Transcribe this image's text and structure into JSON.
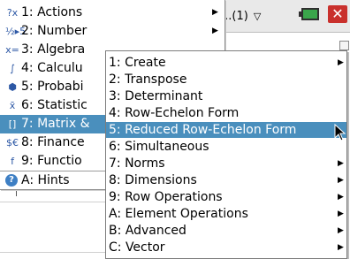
{
  "document": {
    "tab_label": "e...(1)",
    "tab_caret": "▽",
    "close_label": "✕"
  },
  "main_menu": {
    "items": [
      {
        "label": "1: Actions",
        "icon": "?x"
      },
      {
        "label": "2: Number",
        "icon": "½▸5"
      },
      {
        "label": "3: Algebra",
        "icon": "x="
      },
      {
        "label": "4: Calculu",
        "icon": "∫"
      },
      {
        "label": "5: Probabi",
        "icon": "⬢"
      },
      {
        "label": "6: Statistic",
        "icon": "x̄"
      },
      {
        "label": "7: Matrix &",
        "icon": "[]"
      },
      {
        "label": "8: Finance",
        "icon": "$€"
      },
      {
        "label": "9: Functio",
        "icon": "f"
      }
    ],
    "hint_label": "A: Hints",
    "hint_icon": "?"
  },
  "sub_menu": {
    "items": [
      {
        "label": "1: Create"
      },
      {
        "label": "2: Transpose"
      },
      {
        "label": "3: Determinant"
      },
      {
        "label": "4: Row-Echelon Form"
      },
      {
        "label": "5: Reduced Row-Echelon Form"
      },
      {
        "label": "6: Simultaneous"
      },
      {
        "label": "7: Norms"
      },
      {
        "label": "8: Dimensions"
      },
      {
        "label": "9: Row Operations"
      },
      {
        "label": "A: Element Operations"
      },
      {
        "label": "B: Advanced"
      },
      {
        "label": "C: Vector"
      }
    ]
  },
  "colors": {
    "selection": "#4a8fbd",
    "battery": "#3aa64b",
    "close": "#c9302c"
  }
}
